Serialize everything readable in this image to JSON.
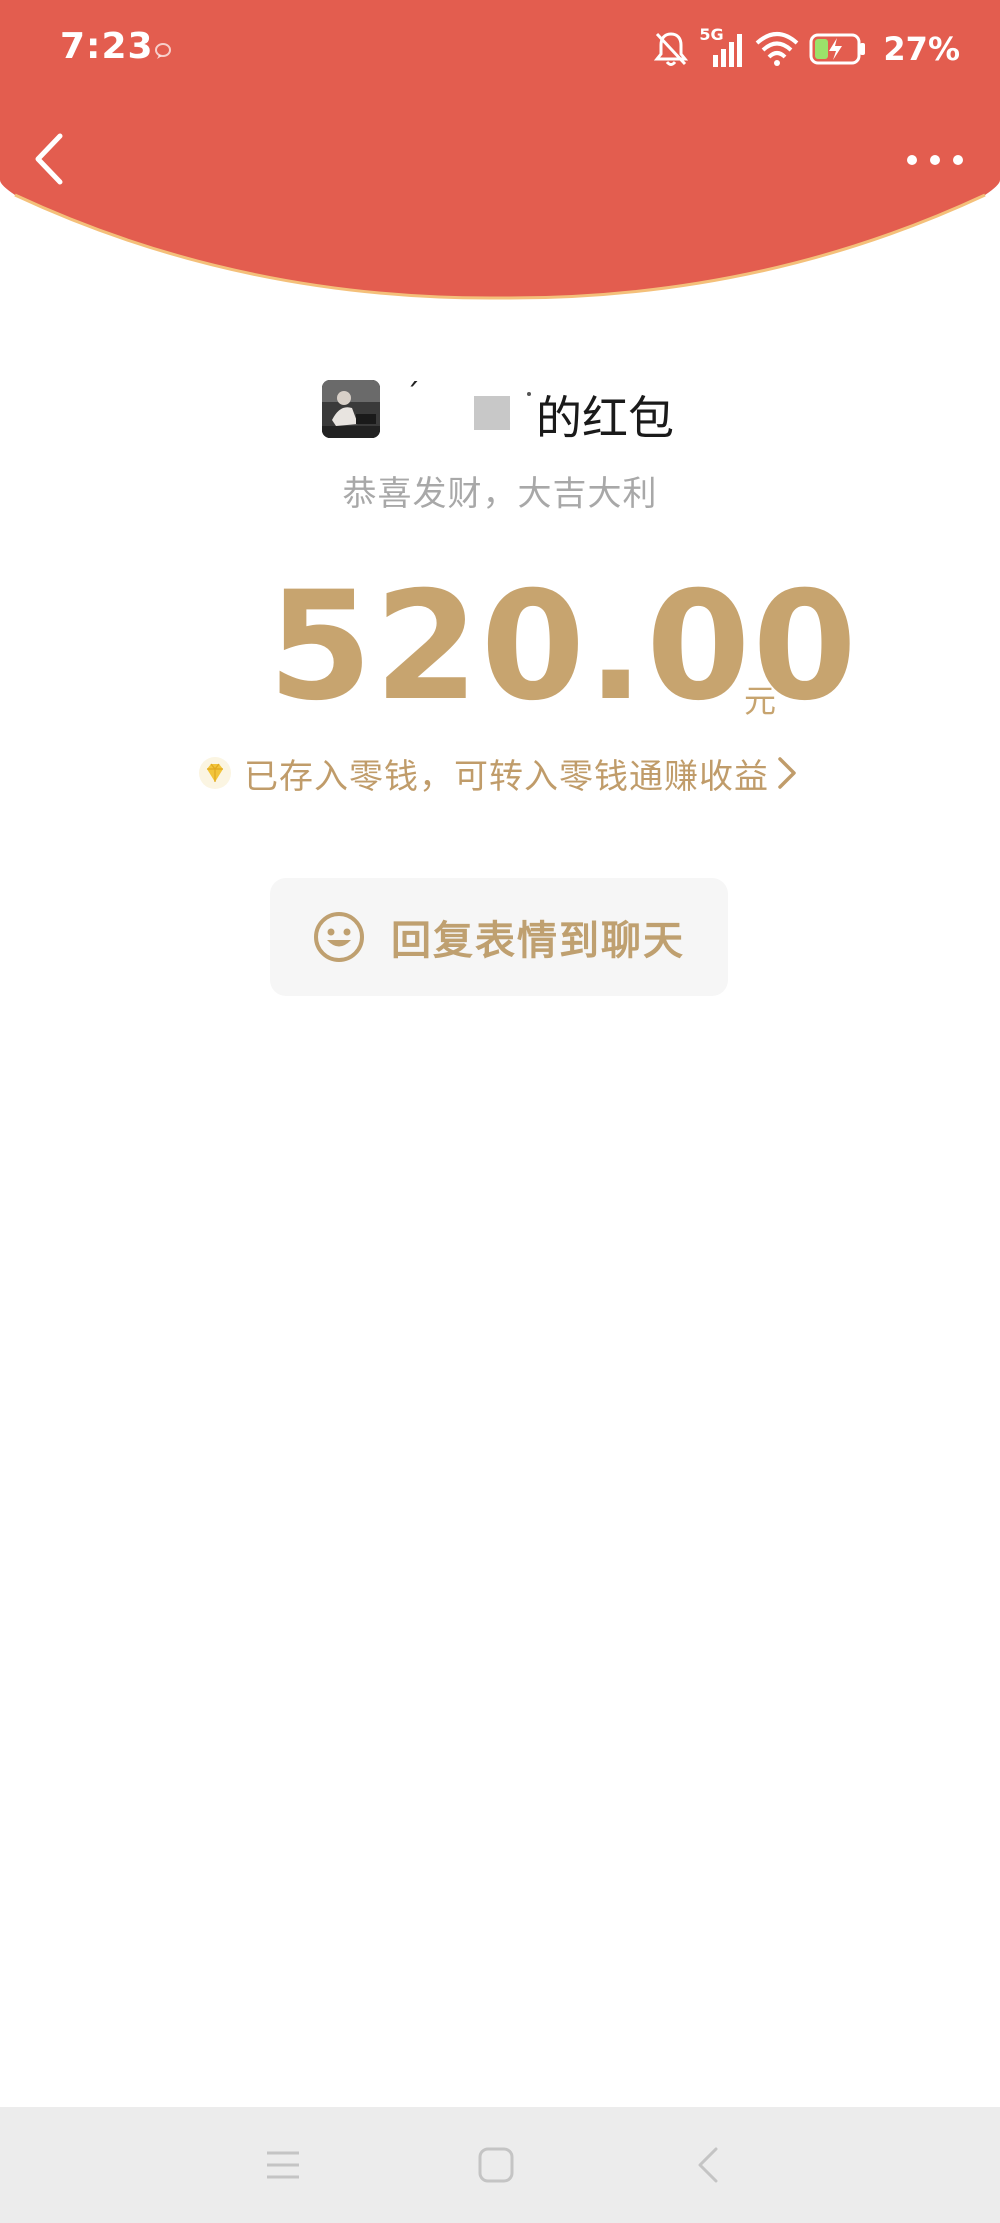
{
  "status_bar": {
    "time": "7:23",
    "network": "5G",
    "battery_percent": "27%",
    "icons": [
      "message-bubble-icon",
      "bell-off-icon",
      "signal-5g-icon",
      "wifi-icon",
      "battery-charging-icon"
    ]
  },
  "header": {
    "back_icon": "chevron-left-icon",
    "more_icon": "more-dots-icon",
    "background_color": "#e35d4f"
  },
  "packet": {
    "sender_mark": "´",
    "title": "的红包",
    "greeting": "恭喜发财，大吉大利",
    "amount": "520.00",
    "unit": "元",
    "change_notice": "已存入零钱，可转入零钱通赚收益",
    "accent_color": "#c7a46f"
  },
  "reply": {
    "label": "回复表情到聊天",
    "icon": "smiley-icon"
  },
  "system_nav": {
    "buttons": [
      "menu-icon",
      "home-icon",
      "back-icon"
    ]
  }
}
